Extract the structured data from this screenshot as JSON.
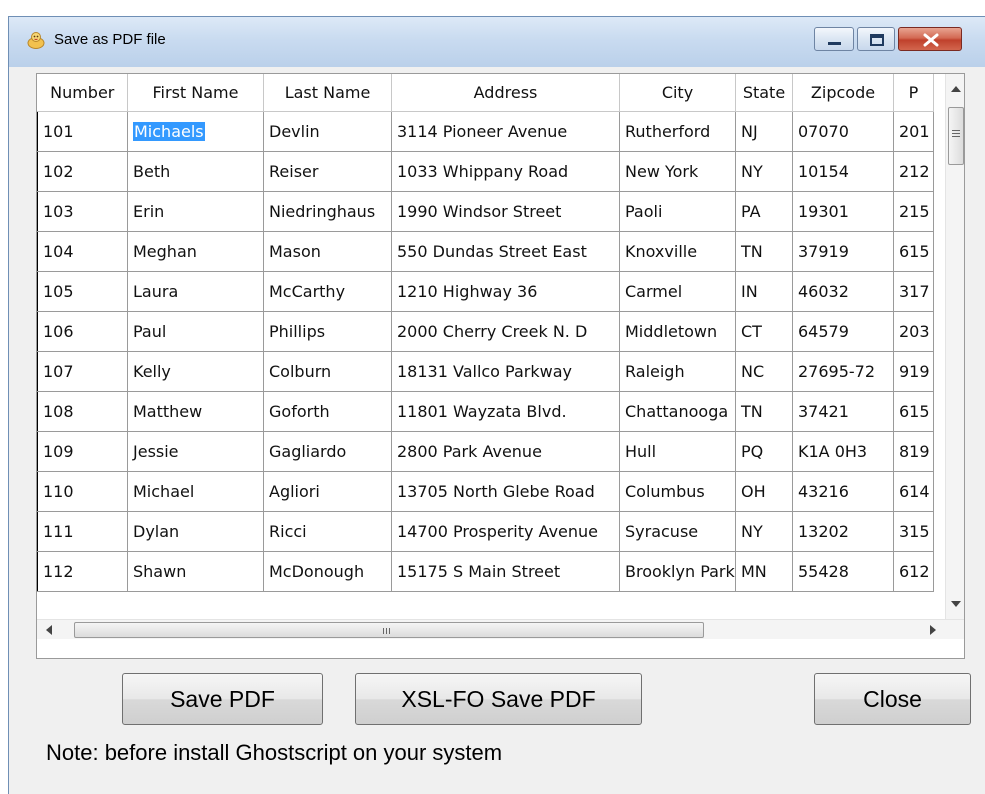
{
  "window": {
    "title": "Save as PDF file"
  },
  "table": {
    "columns": [
      "Number",
      "First Name",
      "Last Name",
      "Address",
      "City",
      "State",
      "Zipcode",
      "P"
    ],
    "rows": [
      [
        "101",
        "Michaels",
        "Devlin",
        "3114 Pioneer Avenue",
        "Rutherford",
        "NJ",
        "07070",
        "201"
      ],
      [
        "102",
        "Beth",
        "Reiser",
        "1033 Whippany Road",
        "New York",
        "NY",
        "10154",
        "212"
      ],
      [
        "103",
        "Erin",
        "Niedringhaus",
        "1990 Windsor Street",
        "Paoli",
        "PA",
        "19301",
        "215"
      ],
      [
        "104",
        "Meghan",
        "Mason",
        "550 Dundas Street East",
        "Knoxville",
        "TN",
        "37919",
        "615"
      ],
      [
        "105",
        "Laura",
        "McCarthy",
        "1210 Highway 36",
        "Carmel",
        "IN",
        "46032",
        "317"
      ],
      [
        "106",
        "Paul",
        "Phillips",
        "2000 Cherry Creek N. D",
        "Middletown",
        "CT",
        "64579",
        "203"
      ],
      [
        "107",
        "Kelly",
        "Colburn",
        "18131 Vallco Parkway",
        "Raleigh",
        "NC",
        "27695-72",
        "919"
      ],
      [
        "108",
        "Matthew",
        "Goforth",
        "11801 Wayzata Blvd.",
        "Chattanooga",
        "TN",
        "37421",
        "615"
      ],
      [
        "109",
        "Jessie",
        "Gagliardo",
        "2800 Park Avenue",
        "Hull",
        "PQ",
        "K1A 0H3",
        "819"
      ],
      [
        "110",
        "Michael",
        "Agliori",
        "13705 North Glebe Road",
        "Columbus",
        "OH",
        "43216",
        "614"
      ],
      [
        "111",
        "Dylan",
        "Ricci",
        "14700 Prosperity Avenue",
        "Syracuse",
        "NY",
        "13202",
        "315"
      ],
      [
        "112",
        "Shawn",
        "McDonough",
        "15175 S Main Street",
        "Brooklyn Park",
        "MN",
        "55428",
        "612"
      ]
    ],
    "selected_cell_text": "Michaels"
  },
  "buttons": {
    "save_pdf": "Save PDF",
    "xslfo_save_pdf": "XSL-FO Save PDF",
    "close": "Close"
  },
  "note": "Note: before install Ghostscript on your system",
  "icons": {
    "app": "app-icon",
    "minimize": "minimize-icon",
    "maximize": "maximize-icon",
    "close": "close-icon"
  },
  "colors": {
    "selection": "#3399ff",
    "title_bar": "#c9dbf0",
    "close_button": "#c0412c"
  }
}
